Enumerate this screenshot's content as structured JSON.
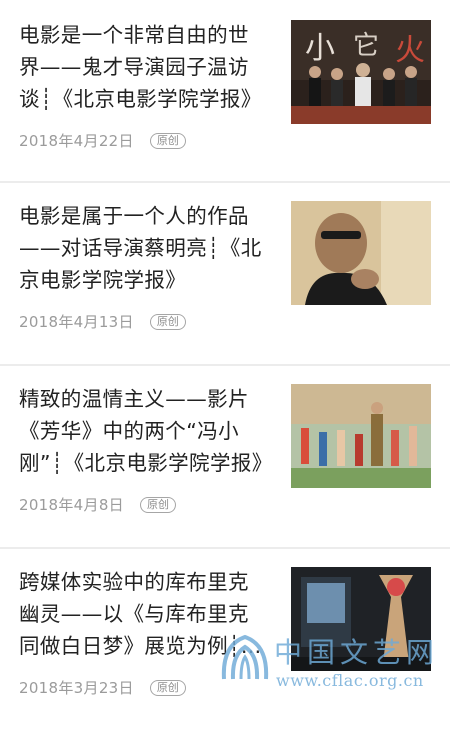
{
  "articles": [
    {
      "title": "电影是一个非常自由的世界——鬼才导演园子温访谈┊《北京电影学院学报》",
      "date": "2018年4月22日",
      "badge": "原创"
    },
    {
      "title": "电影是属于一个人的作品——对话导演蔡明亮┊《北京电影学院学报》",
      "date": "2018年4月13日",
      "badge": "原创"
    },
    {
      "title": "精致的温情主义——影片《芳华》中的两个“冯小刚”┊《北京电影学院学报》",
      "date": "2018年4月8日",
      "badge": "原创"
    },
    {
      "title": "跨媒体实验中的库布里克幽灵——以《与库布里克同做白日梦》展览为例┊《北京电影学院学报》",
      "date": "2018年3月23日",
      "badge": "原创"
    }
  ],
  "watermark": {
    "name": "中国文艺网",
    "url": "www.cflac.org.cn"
  }
}
